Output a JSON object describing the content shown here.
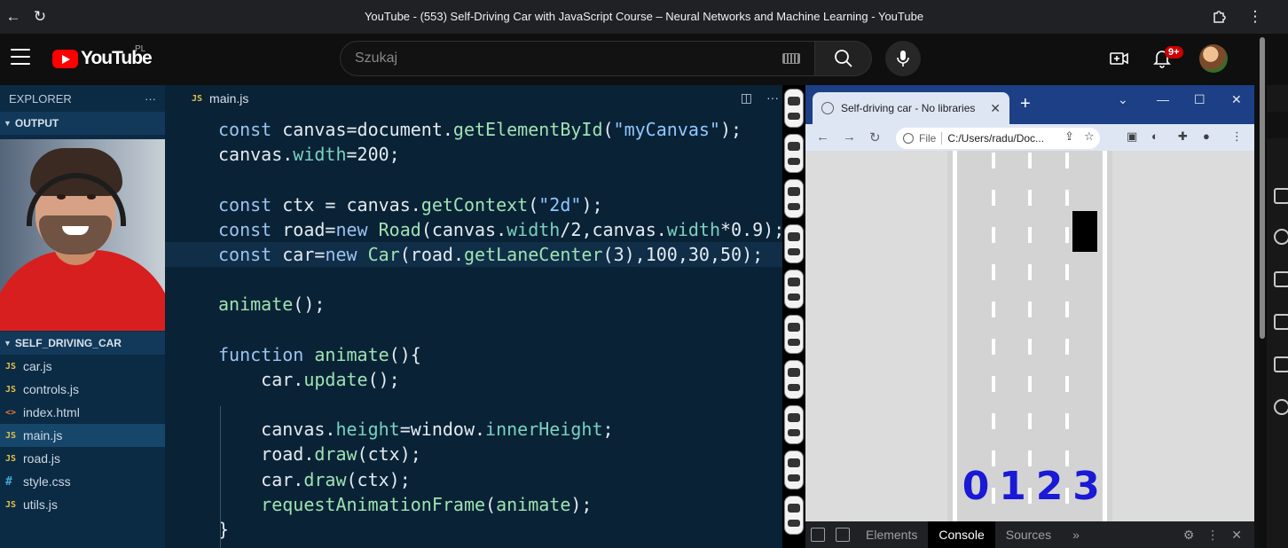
{
  "browser": {
    "window_title": "YouTube - (553) Self-Driving Car with JavaScript Course – Neural Networks and Machine Learning - YouTube"
  },
  "youtube": {
    "logo_text": "YouTube",
    "country_code": "PL",
    "search_placeholder": "Szukaj",
    "notification_count": "9+"
  },
  "vscode": {
    "explorer_title": "EXPLORER",
    "explorer_menu": "···",
    "output_section": "OUTPUT",
    "project_section": "SELF_DRIVING_CAR",
    "files": [
      {
        "icon": "JS",
        "name": "car.js"
      },
      {
        "icon": "JS",
        "name": "controls.js"
      },
      {
        "icon": "<>",
        "name": "index.html"
      },
      {
        "icon": "JS",
        "name": "main.js"
      },
      {
        "icon": "JS",
        "name": "road.js"
      },
      {
        "icon": "#",
        "name": "style.css"
      },
      {
        "icon": "JS",
        "name": "utils.js"
      }
    ],
    "active_file": "main.js",
    "tab_icon": "JS",
    "tab_label": "main.js",
    "code_lines": [
      "const canvas=document.getElementById(\"myCanvas\");",
      "canvas.width=200;",
      "",
      "const ctx = canvas.getContext(\"2d\");",
      "const road=new Road(canvas.width/2,canvas.width*0.9);",
      "const car=new Car(road.getLaneCenter(3),100,30,50);",
      "",
      "animate();",
      "",
      "function animate(){",
      "    car.update();",
      "",
      "    canvas.height=window.innerHeight;",
      "    road.draw(ctx);",
      "    car.draw(ctx);",
      "    requestAnimationFrame(animate);",
      "}"
    ]
  },
  "chrome": {
    "tab_title": "Self-driving car - No libraries",
    "address_scheme": "File",
    "address": "C:/Users/radu/Doc...",
    "lane_numbers": [
      "0",
      "1",
      "2",
      "3"
    ],
    "car_lane": 3,
    "lane_count": 4,
    "devtools_tabs": [
      "Elements",
      "Console",
      "Sources"
    ],
    "devtools_active": "Console",
    "devtools_more": "»"
  },
  "colors": {
    "youtube_red": "#ff0000",
    "editor_bg": "#0a2236",
    "sidebar_bg": "#0b2a44",
    "lane_number_blue": "#1919d6",
    "chrome_tabstrip": "#1c3f86"
  }
}
